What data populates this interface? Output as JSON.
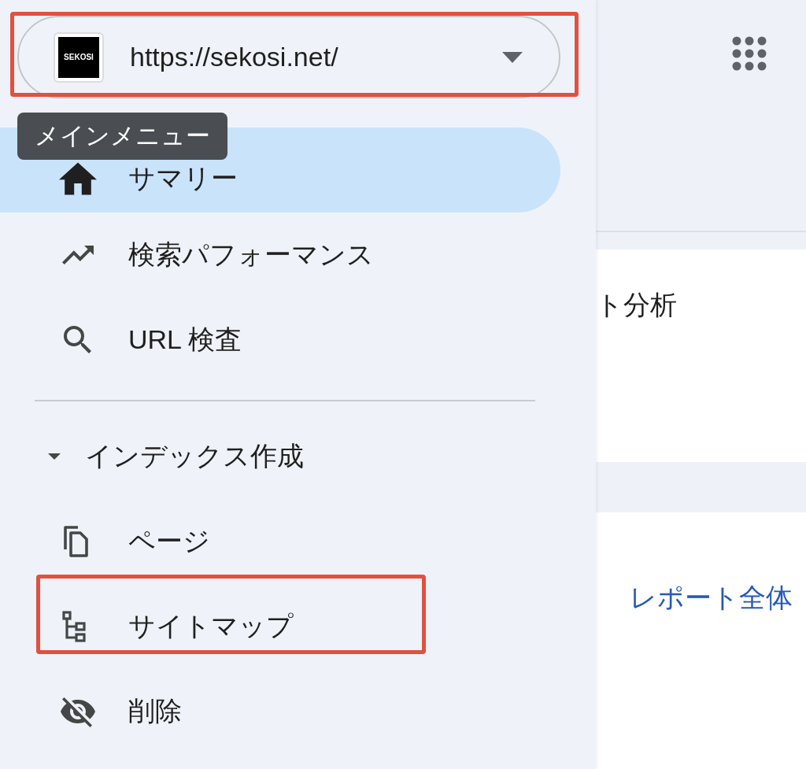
{
  "property_selector": {
    "favicon_text": "SEKOSI",
    "url": "https://sekosi.net/",
    "annotated": true
  },
  "tooltip": {
    "text": "メインメニュー"
  },
  "nav_items": [
    {
      "label": "サマリー",
      "selected": true
    },
    {
      "label": "検索パフォーマンス",
      "selected": false
    },
    {
      "label": "URL 検査",
      "selected": false
    }
  ],
  "section": {
    "label": "インデックス作成",
    "expanded": true,
    "children": [
      {
        "label": "ページ",
        "selected": false,
        "annotated": false
      },
      {
        "label": "サイトマップ",
        "selected": false,
        "annotated": true
      },
      {
        "label": "削除",
        "selected": false,
        "annotated": false
      }
    ]
  },
  "main": {
    "card_title": "ト分析",
    "link": "レポート全体"
  }
}
